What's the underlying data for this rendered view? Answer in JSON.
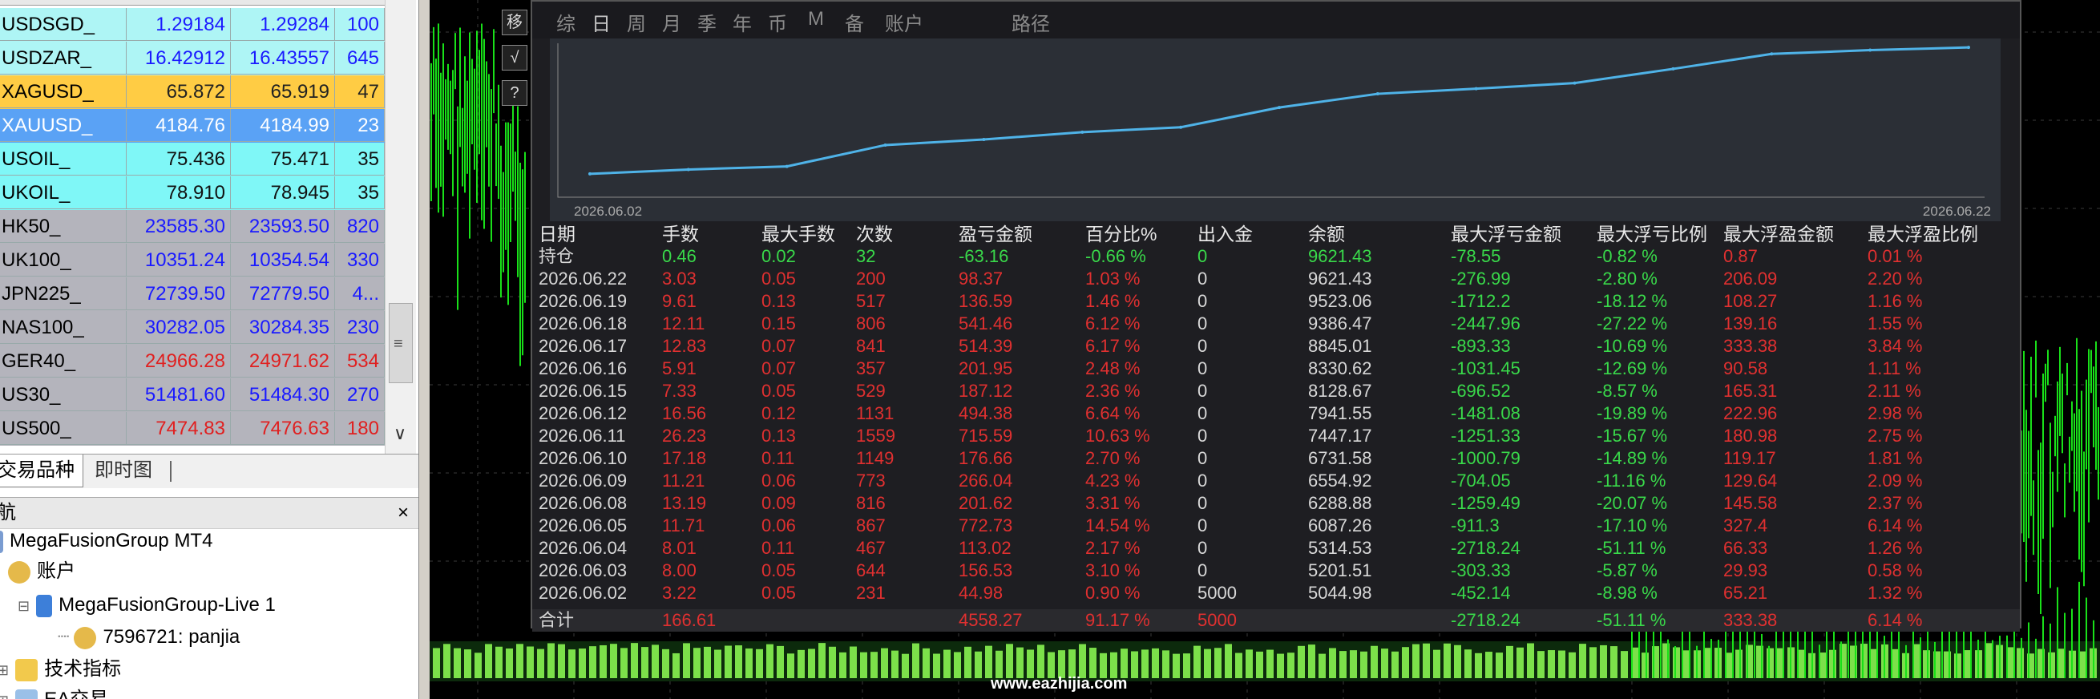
{
  "market_watch": {
    "rows": [
      {
        "symbol": "USDSGD_",
        "bid": "1.29184",
        "ask": "1.29284",
        "spread": "100",
        "bg": "#aef5f5",
        "color": "#1a1aff"
      },
      {
        "symbol": "USDZAR_",
        "bid": "16.42912",
        "ask": "16.43557",
        "spread": "645",
        "bg": "#aef5f5",
        "color": "#1a1aff"
      },
      {
        "symbol": "XAGUSD_",
        "bid": "65.872",
        "ask": "65.919",
        "spread": "47",
        "bg": "#ffcc44",
        "color": "#222222"
      },
      {
        "symbol": "XAUUSD_",
        "bid": "4184.76",
        "ask": "4184.99",
        "spread": "23",
        "bg": "#5aa2f5",
        "color": "#ffffff"
      },
      {
        "symbol": "USOIL_",
        "bid": "75.436",
        "ask": "75.471",
        "spread": "35",
        "bg": "#7ff7f7",
        "color": "#111111"
      },
      {
        "symbol": "UKOIL_",
        "bid": "78.910",
        "ask": "78.945",
        "spread": "35",
        "bg": "#7ff7f7",
        "color": "#111111"
      },
      {
        "symbol": "HK50_",
        "bid": "23585.30",
        "ask": "23593.50",
        "spread": "820",
        "bg": "#b4b4bc",
        "color": "#1a1aff"
      },
      {
        "symbol": "UK100_",
        "bid": "10351.24",
        "ask": "10354.54",
        "spread": "330",
        "bg": "#b4b4bc",
        "color": "#1a1aff"
      },
      {
        "symbol": "JPN225_",
        "bid": "72739.50",
        "ask": "72779.50",
        "spread": "4...",
        "bg": "#b4b4bc",
        "color": "#1a1aff"
      },
      {
        "symbol": "NAS100_",
        "bid": "30282.05",
        "ask": "30284.35",
        "spread": "230",
        "bg": "#b4b4bc",
        "color": "#1a1aff"
      },
      {
        "symbol": "GER40_",
        "bid": "24966.28",
        "ask": "24971.62",
        "spread": "534",
        "bg": "#b4b4bc",
        "color": "#e02020"
      },
      {
        "symbol": "US30_",
        "bid": "51481.60",
        "ask": "51484.30",
        "spread": "270",
        "bg": "#b4b4bc",
        "color": "#1a1aff"
      },
      {
        "symbol": "US500_",
        "bid": "7474.83",
        "ask": "7476.63",
        "spread": "180",
        "bg": "#b4b4bc",
        "color": "#e02020"
      }
    ],
    "tabs": {
      "symbols": "交易品种",
      "tick_chart": "即时图"
    }
  },
  "navigator": {
    "title": "航",
    "close": "×",
    "broker": "MegaFusionGroup MT4",
    "accounts": "账户",
    "server": "MegaFusionGroup-Live 1",
    "account": "7596721: panjia",
    "indicators": "技术指标",
    "ea": "EA交易"
  },
  "side_buttons": [
    "移",
    "√",
    "?"
  ],
  "watermark": "www.eazhijia.com",
  "report": {
    "tabs": [
      "综",
      "日",
      "周",
      "月",
      "季",
      "年",
      "币",
      "M",
      "备",
      "账户",
      "路径"
    ],
    "active_tab": "日",
    "graph": {
      "start": "2026.06.02",
      "end": "2026.06.22",
      "line_color": "#4fb3e8"
    },
    "headers": [
      "日期",
      "手数",
      "最大手数",
      "次数",
      "盈亏金额",
      "百分比%",
      "出入金",
      "余额",
      "最大浮亏金额",
      "最大浮亏比例",
      "最大浮盈金额",
      "最大浮盈比例"
    ],
    "position_row": [
      "持仓",
      "0.46",
      "0.02",
      "32",
      "-63.16",
      "-0.66 %",
      "0",
      "9621.43",
      "-78.55",
      "-0.82 %",
      "0.87",
      "0.01 %"
    ],
    "rows": [
      [
        "2026.06.22",
        "3.03",
        "0.05",
        "200",
        "98.37",
        "1.03 %",
        "0",
        "9621.43",
        "-276.99",
        "-2.80 %",
        "206.09",
        "2.20 %"
      ],
      [
        "2026.06.19",
        "9.61",
        "0.13",
        "517",
        "136.59",
        "1.46 %",
        "0",
        "9523.06",
        "-1712.2",
        "-18.12 %",
        "108.27",
        "1.16 %"
      ],
      [
        "2026.06.18",
        "12.11",
        "0.15",
        "806",
        "541.46",
        "6.12 %",
        "0",
        "9386.47",
        "-2447.96",
        "-27.22 %",
        "139.16",
        "1.55 %"
      ],
      [
        "2026.06.17",
        "12.83",
        "0.07",
        "841",
        "514.39",
        "6.17 %",
        "0",
        "8845.01",
        "-893.33",
        "-10.69 %",
        "333.38",
        "3.84 %"
      ],
      [
        "2026.06.16",
        "5.91",
        "0.07",
        "357",
        "201.95",
        "2.48 %",
        "0",
        "8330.62",
        "-1031.45",
        "-12.69 %",
        "90.58",
        "1.11 %"
      ],
      [
        "2026.06.15",
        "7.33",
        "0.05",
        "529",
        "187.12",
        "2.36 %",
        "0",
        "8128.67",
        "-696.52",
        "-8.57 %",
        "165.31",
        "2.11 %"
      ],
      [
        "2026.06.12",
        "16.56",
        "0.12",
        "1131",
        "494.38",
        "6.64 %",
        "0",
        "7941.55",
        "-1481.08",
        "-19.89 %",
        "222.96",
        "2.98 %"
      ],
      [
        "2026.06.11",
        "26.23",
        "0.13",
        "1559",
        "715.59",
        "10.63 %",
        "0",
        "7447.17",
        "-1251.33",
        "-15.67 %",
        "180.98",
        "2.75 %"
      ],
      [
        "2026.06.10",
        "17.18",
        "0.11",
        "1149",
        "176.66",
        "2.70 %",
        "0",
        "6731.58",
        "-1000.79",
        "-14.89 %",
        "119.17",
        "1.81 %"
      ],
      [
        "2026.06.09",
        "11.21",
        "0.06",
        "773",
        "266.04",
        "4.23 %",
        "0",
        "6554.92",
        "-704.05",
        "-11.16 %",
        "129.64",
        "2.09 %"
      ],
      [
        "2026.06.08",
        "13.19",
        "0.09",
        "816",
        "201.62",
        "3.31 %",
        "0",
        "6288.88",
        "-1259.49",
        "-20.07 %",
        "145.58",
        "2.37 %"
      ],
      [
        "2026.06.05",
        "11.71",
        "0.06",
        "867",
        "772.73",
        "14.54 %",
        "0",
        "6087.26",
        "-911.3",
        "-17.10 %",
        "327.4",
        "6.14 %"
      ],
      [
        "2026.06.04",
        "8.01",
        "0.11",
        "467",
        "113.02",
        "2.17 %",
        "0",
        "5314.53",
        "-2718.24",
        "-51.11 %",
        "66.33",
        "1.26 %"
      ],
      [
        "2026.06.03",
        "8.00",
        "0.05",
        "644",
        "156.53",
        "3.10 %",
        "0",
        "5201.51",
        "-303.33",
        "-5.87 %",
        "29.93",
        "0.58 %"
      ],
      [
        "2026.06.02",
        "3.22",
        "0.05",
        "231",
        "44.98",
        "0.90 %",
        "5000",
        "5044.98",
        "-452.14",
        "-8.98 %",
        "65.21",
        "1.32 %"
      ]
    ],
    "total_row": [
      "合计",
      "166.61",
      "",
      "",
      "4558.27",
      "91.17 %",
      "5000",
      "",
      "-2718.24",
      "-51.11 %",
      "333.38",
      "6.14 %"
    ]
  },
  "chart_data": {
    "type": "line",
    "x": [
      "2026.06.02",
      "2026.06.03",
      "2026.06.04",
      "2026.06.05",
      "2026.06.08",
      "2026.06.09",
      "2026.06.10",
      "2026.06.11",
      "2026.06.12",
      "2026.06.15",
      "2026.06.16",
      "2026.06.17",
      "2026.06.18",
      "2026.06.19",
      "2026.06.22"
    ],
    "series": [
      {
        "values": [
          5044.98,
          5201.51,
          5314.53,
          6087.26,
          6288.88,
          6554.92,
          6731.58,
          7447.17,
          7941.55,
          8128.67,
          8330.62,
          8845.01,
          9386.47,
          9523.06,
          9621.43
        ]
      }
    ],
    "xlabel": "",
    "ylabel": ""
  }
}
